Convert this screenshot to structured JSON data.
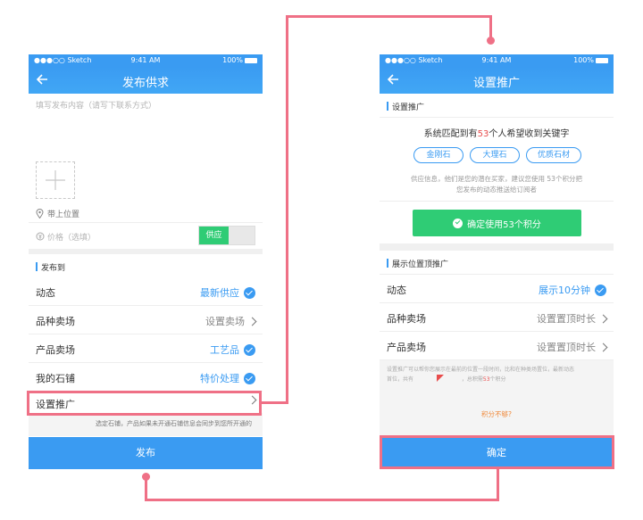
{
  "left": {
    "status": {
      "carrier": "●●●○○ Sketch",
      "time": "9:41 AM",
      "battery": "100%"
    },
    "title": "发布供求",
    "content_placeholder": "填写发布内容（请写下联系方式）",
    "location": "带上位置",
    "price_placeholder": "价格（选填）",
    "toggle_on": "供应",
    "publish_to_heading": "发布到",
    "rows": [
      {
        "label": "动态",
        "value": "最新供应"
      },
      {
        "label": "品种卖场",
        "value": "设置卖场"
      },
      {
        "label": "产品卖场",
        "value": "工艺品"
      },
      {
        "label": "我的石铺",
        "value": "特价处理"
      }
    ],
    "promo_row": "设置推广",
    "note": "选定石铺，产品如果未开通石铺信息会同步到您所开通的",
    "publish_button": "发布"
  },
  "right": {
    "status": {
      "carrier": "●●●○○ Sketch",
      "time": "9:41 AM",
      "battery": "100%"
    },
    "title": "设置推广",
    "section1": "设置推广",
    "match_prefix": "系统匹配到有",
    "match_count": "53",
    "match_suffix": "个人希望收到关键字",
    "tags": [
      "金刚石",
      "大理石",
      "优质石材"
    ],
    "desc_line1": "供应信息，他们是您的潜在买家，建议您使用 53个积分把",
    "desc_line2": "您发布的动态推送给订阅者",
    "confirm_points": "确定使用53个积分",
    "section2": "展示位置顶推广",
    "rows": [
      {
        "label": "动态",
        "value": "展示10分钟"
      },
      {
        "label": "品种卖场",
        "value": "设置置顶时长"
      },
      {
        "label": "产品卖场",
        "value": "设置置顶时长"
      }
    ],
    "note_line1": "设置推广可以帮你您展示在最前的位置一段时间，比和在种类场置位，最新动态",
    "note_line2_a": "首位，共有",
    "note_line2_b": "，总积需",
    "note_points": "53",
    "note_line2_c": "个积分",
    "insufficient": "积分不够?",
    "confirm_button": "确定"
  },
  "colors": {
    "accent": "#3a9bf2",
    "green": "#2fcc75",
    "highlight": "#ef7086",
    "red": "#e84c4c",
    "orange": "#f08a3c"
  }
}
